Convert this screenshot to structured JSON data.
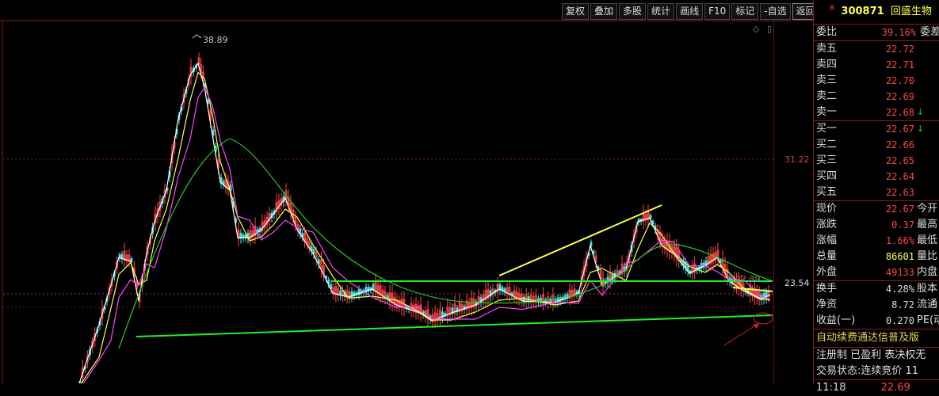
{
  "toolbar": [
    "复权",
    "叠加",
    "多股",
    "统计",
    "画线",
    "F10",
    "标记",
    "-自选",
    "返回"
  ],
  "chart": {
    "peak_label": "38.89",
    "right_axis": [
      "31.22",
      "23.54"
    ],
    "ma_label": "22.39"
  },
  "colors": {
    "up": "#ff4545",
    "down": "#22cc22",
    "yellow": "#ffff44",
    "trend_green": "#22ee22",
    "bg": "#000000"
  },
  "stock": {
    "flag": "R",
    "code": "300871",
    "name": "回盛生物"
  },
  "order_book": {
    "ratio_label": "委比",
    "ratio_value": "39.16%",
    "diff_label": "委差",
    "sells": [
      {
        "label": "卖五",
        "price": "22.72",
        "arrow": ""
      },
      {
        "label": "卖四",
        "price": "22.71",
        "arrow": ""
      },
      {
        "label": "卖三",
        "price": "22.70",
        "arrow": ""
      },
      {
        "label": "卖二",
        "price": "22.69",
        "arrow": ""
      },
      {
        "label": "卖一",
        "price": "22.68",
        "arrow": "↓"
      }
    ],
    "buys": [
      {
        "label": "买一",
        "price": "22.67",
        "arrow": "↓"
      },
      {
        "label": "买二",
        "price": "22.66",
        "arrow": ""
      },
      {
        "label": "买三",
        "price": "22.65",
        "arrow": ""
      },
      {
        "label": "买四",
        "price": "22.64",
        "arrow": ""
      },
      {
        "label": "买五",
        "price": "22.63",
        "arrow": ""
      }
    ]
  },
  "quote": [
    {
      "label": "现价",
      "value": "22.67",
      "right": "今开",
      "color": "#ff4545"
    },
    {
      "label": "涨跌",
      "value": "0.37",
      "right": "最高",
      "color": "#ff4545"
    },
    {
      "label": "涨幅",
      "value": "1.66%",
      "right": "最低",
      "color": "#ff4545"
    },
    {
      "label": "总量",
      "value": "86601",
      "right": "量比",
      "color": "#ffff44"
    },
    {
      "label": "外盘",
      "value": "49133",
      "right": "内盘",
      "color": "#ff4545"
    }
  ],
  "stats": [
    {
      "label": "换手",
      "value": "4.28%",
      "right": "股本"
    },
    {
      "label": "净资",
      "value": "8.72",
      "right": "流通"
    },
    {
      "label": "收益(一)",
      "value": "0.270",
      "right": "PE(动"
    }
  ],
  "tags": "自动续费通达信普及版",
  "info1": "注册制 已盈利 表决权无",
  "info2": "交易状态:连续竞价 11",
  "tick": {
    "time": "11:18",
    "price": "22.69"
  }
}
